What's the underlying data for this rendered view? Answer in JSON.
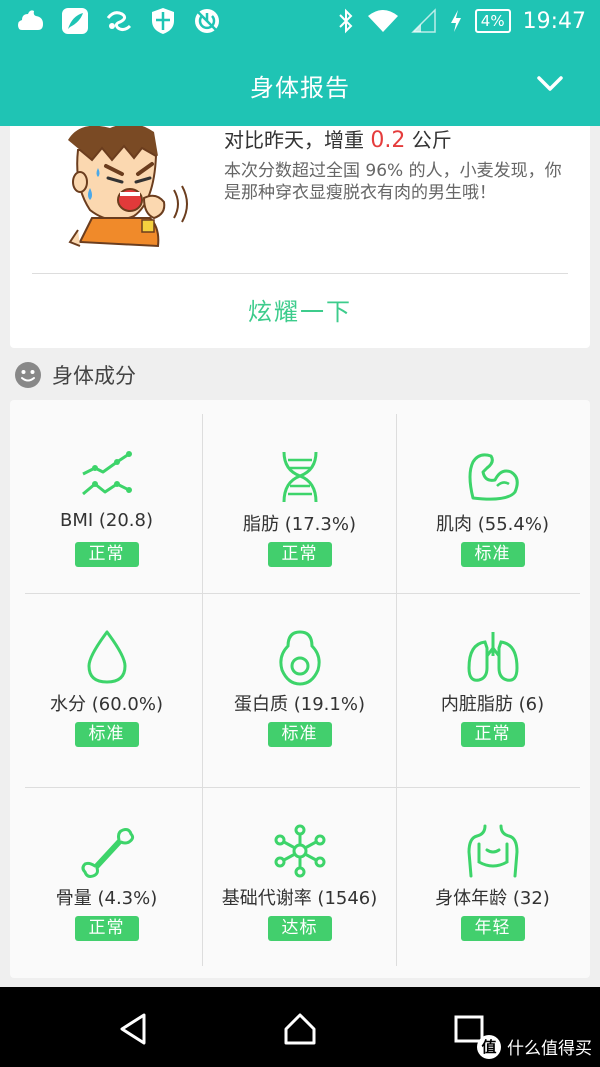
{
  "status_bar": {
    "battery_percent": "4%",
    "time": "19:47",
    "left_icons": [
      "cloud-app-icon",
      "feather-app-icon",
      "swirl-app-icon",
      "shield-app-icon",
      "power-app-icon"
    ],
    "right_icons": [
      "bluetooth-icon",
      "wifi-icon",
      "signal-icon",
      "charging-icon"
    ]
  },
  "header": {
    "title": "身体报告"
  },
  "summary": {
    "compare_prefix": "对比昨天，增重",
    "compare_value": "0.2",
    "compare_unit": "公斤",
    "description": "本次分数超过全国 96% 的人，小麦发现，你是那种穿衣显瘦脱衣有肉的男生哦！",
    "share_label": "炫耀一下"
  },
  "composition": {
    "section_title": "身体成分",
    "items": [
      {
        "label": "BMI (20.8)",
        "status": "正常",
        "icon": "trend-lines-icon"
      },
      {
        "label": "脂肪 (17.3%)",
        "status": "正常",
        "icon": "dna-icon"
      },
      {
        "label": "肌肉 (55.4%)",
        "status": "标准",
        "icon": "muscle-arm-icon"
      },
      {
        "label": "水分 (60.0%)",
        "status": "标准",
        "icon": "water-drop-icon"
      },
      {
        "label": "蛋白质 (19.1%)",
        "status": "标准",
        "icon": "avocado-icon"
      },
      {
        "label": "内脏脂肪 (6)",
        "status": "正常",
        "icon": "lungs-icon"
      },
      {
        "label": "骨量 (4.3%)",
        "status": "正常",
        "icon": "bone-icon"
      },
      {
        "label": "基础代谢率 (1546)",
        "status": "达标",
        "icon": "molecule-icon"
      },
      {
        "label": "身体年龄 (32)",
        "status": "年轻",
        "icon": "body-torso-icon"
      }
    ]
  },
  "colors": {
    "brand": "#1fc4b4",
    "accent_green": "#42cf6d",
    "icon_green": "#3dd46a",
    "weight_red": "#e53c3c",
    "share_green": "#3dcc8c"
  },
  "watermark": {
    "glyph": "值",
    "text": "什么值得买"
  }
}
